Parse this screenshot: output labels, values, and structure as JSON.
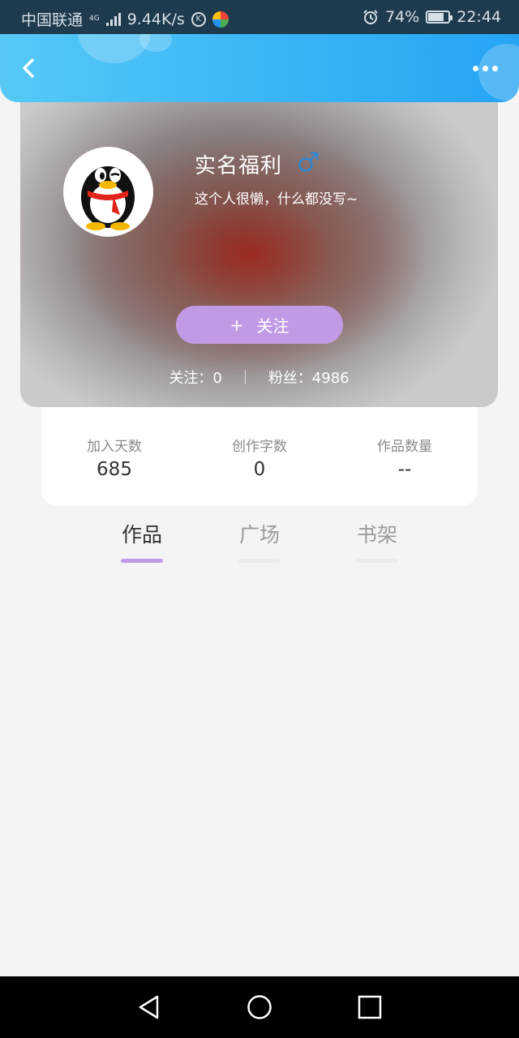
{
  "status_bar": {
    "carrier": "中国联通",
    "network_type": "4G",
    "speed": "9.44K/s",
    "badge_letter": "K",
    "battery_percent": "74%",
    "battery_level": 0.74,
    "time": "22:44"
  },
  "header": {
    "back_icon": "chevron-left-icon",
    "more_icon": "more-horizontal-icon",
    "accent": "#3bb6f6"
  },
  "profile": {
    "avatar_icon": "penguin-avatar-icon",
    "name": "实名福利",
    "gender_icon": "male-icon",
    "gender_color": "#2f86d1",
    "bio": "这个人很懒，什么都没写~",
    "follow_plus": "+",
    "follow_label": "关注",
    "follow_color": "#c19ae6",
    "following_text": "关注：0",
    "fans_text": "粉丝：4986"
  },
  "stats": [
    {
      "label": "加入天数",
      "value": "685"
    },
    {
      "label": "创作字数",
      "value": "0"
    },
    {
      "label": "作品数量",
      "value": "--"
    }
  ],
  "tabs": [
    {
      "label": "作品",
      "active": true
    },
    {
      "label": "广场",
      "active": false
    },
    {
      "label": "书架",
      "active": false
    }
  ],
  "nav_bar": {
    "back_icon": "triangle-back-icon",
    "home_icon": "circle-home-icon",
    "recent_icon": "square-recent-icon"
  }
}
